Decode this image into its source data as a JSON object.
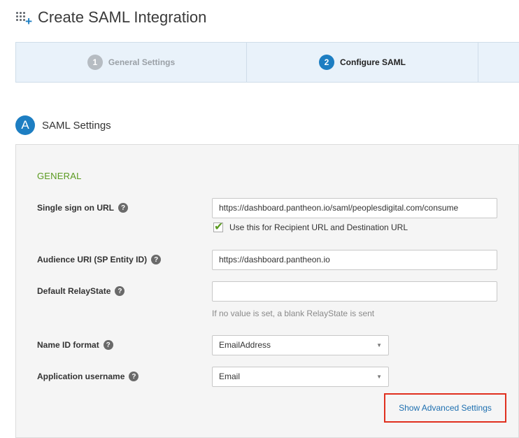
{
  "header": {
    "title": "Create SAML Integration",
    "icon": "add-app-grid-icon"
  },
  "wizard": {
    "steps": [
      {
        "number": "1",
        "label": "General Settings",
        "state": "completed"
      },
      {
        "number": "2",
        "label": "Configure SAML",
        "state": "active"
      }
    ]
  },
  "section": {
    "badge": "A",
    "title": "SAML Settings"
  },
  "general": {
    "title": "GENERAL",
    "sso_url": {
      "label": "Single sign on URL",
      "value": "https://dashboard.pantheon.io/saml/peoplesdigital.com/consume"
    },
    "recipient_checkbox": {
      "label": "Use this for Recipient URL and Destination URL",
      "checked": true
    },
    "audience_uri": {
      "label": "Audience URI (SP Entity ID)",
      "value": "https://dashboard.pantheon.io"
    },
    "relay_state": {
      "label": "Default RelayState",
      "value": "",
      "hint": "If no value is set, a blank RelayState is sent"
    },
    "name_id_format": {
      "label": "Name ID format",
      "value": "EmailAddress"
    },
    "app_username": {
      "label": "Application username",
      "value": "Email"
    },
    "advanced_link": "Show Advanced Settings",
    "help_glyph": "?"
  },
  "colors": {
    "accent": "#1d7ec2",
    "green": "#5a9a20",
    "highlight": "#e0301e"
  }
}
